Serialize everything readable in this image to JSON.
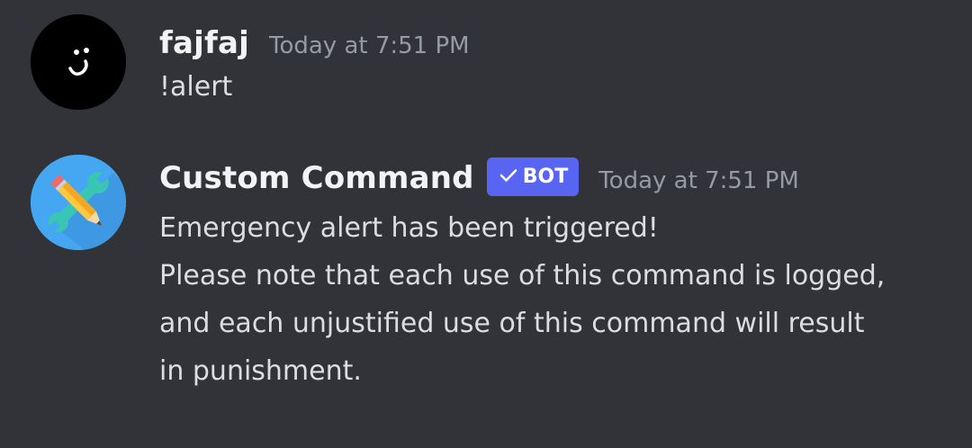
{
  "messages": [
    {
      "author": "fajfaj",
      "timestamp": "Today at 7:51 PM",
      "avatar_icon": "smiley-face-icon",
      "lines": [
        "!alert"
      ]
    },
    {
      "author": "Custom Command",
      "badge": "BOT",
      "timestamp": "Today at 7:51 PM",
      "avatar_icon": "tools-pencil-wrench-icon",
      "lines": [
        "Emergency alert has been triggered!",
        "Please note that each use of this command is logged,",
        "and each unjustified use of this command will result",
        "in punishment."
      ]
    }
  ],
  "colors": {
    "background": "#313338",
    "username": "#f2f3f5",
    "timestamp": "#949ba4",
    "message_text": "#dbdee1",
    "bot_badge": "#5865f2",
    "bot_avatar": "#45a6f2"
  }
}
